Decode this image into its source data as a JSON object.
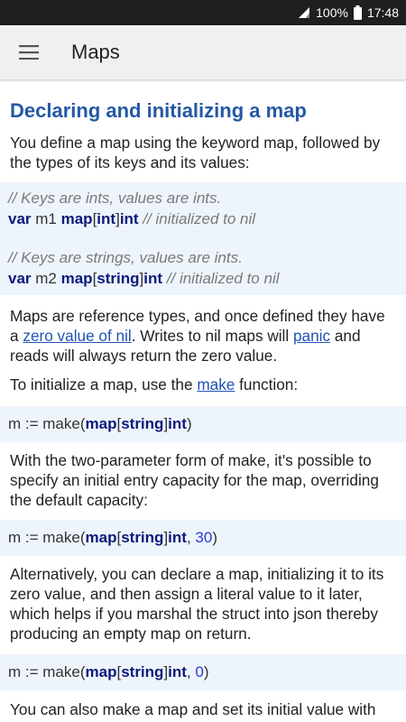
{
  "status_bar": {
    "battery": "100%",
    "time": "17:48"
  },
  "app_bar": {
    "title": "Maps",
    "menu_icon": "hamburger-menu-icon"
  },
  "section": {
    "title": "Declaring and initializing a map",
    "intro": [
      "You define a map using the keyword map, followed by",
      "the types of its keys and its values:"
    ]
  },
  "code1": {
    "comment1": "// Keys are ints, values are ints.",
    "line1": {
      "kw": "var",
      "name": " m1 ",
      "map": "map",
      "open": "[",
      "key": "int",
      "close": "]",
      "val": "int",
      "comment": " // initialized to nil"
    },
    "comment2": "// Keys are strings, values are ints.",
    "line2": {
      "kw": "var",
      "name": " m2 ",
      "map": "map",
      "open": "[",
      "key": "string",
      "close": "]",
      "val": "int",
      "comment": " // initialized to nil"
    }
  },
  "para2": {
    "line1": "Maps are reference types, and once defined they have",
    "pre_link1": "a ",
    "link1": "zero value of nil",
    "mid": ". Writes to nil maps will ",
    "link2": "panic",
    "post": " and",
    "line3": "reads will always return the zero value."
  },
  "para3": {
    "pre": "To initialize a map, use the ",
    "link": "make",
    "post": " function:"
  },
  "code2": {
    "pre": "m := make(",
    "map": "map",
    "open": "[",
    "key": "string",
    "close": "]",
    "val": "int",
    "end": ")"
  },
  "para4": [
    "With the two-parameter form of make, it's possible to",
    "specify an initial entry capacity for the map, overriding",
    "the default capacity:"
  ],
  "code3": {
    "pre": "m := make(",
    "map": "map",
    "open": "[",
    "key": "string",
    "close": "]",
    "val": "int",
    "sep": ", ",
    "num": "30",
    "end": ")"
  },
  "para5": [
    "Alternatively, you can declare a map, initializing it to its",
    "zero value, and then assign a literal value to it later,",
    "which helps if you marshal the struct into json thereby",
    "producing an empty map on return."
  ],
  "code4": {
    "pre": "m := make(",
    "map": "map",
    "open": "[",
    "key": "string",
    "close": "]",
    "val": "int",
    "sep": ", ",
    "num": "0",
    "end": ")"
  },
  "para6": [
    "You can also make a map and set its initial value with"
  ],
  "colors": {
    "accent": "#2458a6",
    "link": "#2153b4",
    "code_bg": "#eef4fb",
    "keyword": "#0b1a7a",
    "number": "#2a3bd1",
    "comment": "#7a7a7a",
    "status_bar": "#1f1f1f",
    "app_bar": "#f0f0f0"
  }
}
